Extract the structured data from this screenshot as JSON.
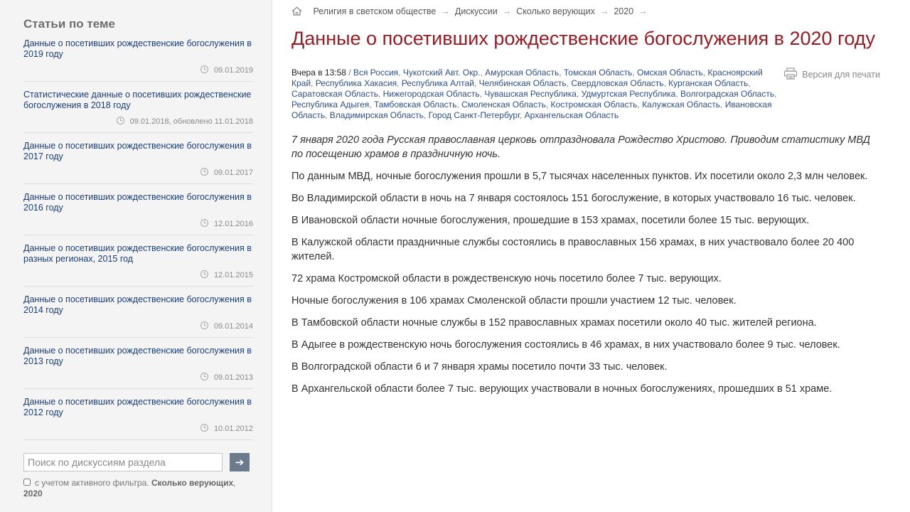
{
  "sidebar": {
    "title": "Статьи по теме",
    "articles": [
      {
        "title": "Данные о посетивших рождественские богослужения в 2019 году",
        "date": "09.01.2019"
      },
      {
        "title": "Статистические данные о посетивших рождественские богослужения в 2018 году",
        "date": "09.01.2018, обновлено 11.01.2018"
      },
      {
        "title": "Данные о посетивших рождественские богослужения в 2017 году",
        "date": "09.01.2017"
      },
      {
        "title": "Данные о посетивших рождественские богослужения в 2016 году",
        "date": "12.01.2016"
      },
      {
        "title": "Данные о посетивших рождественские богослужения в разных регионах, 2015 год",
        "date": "12.01.2015"
      },
      {
        "title": "Данные о посетивших рождественские богослужения в 2014 году",
        "date": "09.01.2014"
      },
      {
        "title": "Данные о посетивших рождественские богослужения в 2013 году",
        "date": "09.01.2013"
      },
      {
        "title": "Данные о посетивших рождественские богослужения в 2012 году",
        "date": "10.01.2012"
      }
    ],
    "search": {
      "placeholder": "Поиск по дискуссиям раздела",
      "button": "➔"
    },
    "filter": {
      "label": "с учетом активного фильтра.",
      "active": "Сколько верующих",
      "sep": ",",
      "year": "2020"
    }
  },
  "breadcrumb": {
    "items": [
      "Религия в светском обществе",
      "Дискуссии",
      "Сколько верующих",
      "2020"
    ],
    "arrow": "→"
  },
  "article": {
    "title": "Данные о посетивших рождественские богослужения в 2020 году",
    "time": "Вчера в 13:58",
    "slash": " / ",
    "regions": [
      "Вся Россия",
      "Чукотский Авт. Окр.",
      "Амурская Область",
      "Томская Область",
      "Омская Область",
      "Красноярский Край",
      "Республика Хакасия",
      "Республика Алтай",
      "Челябинская Область",
      "Свердловская Область",
      "Курганская Область",
      "Саратовская Область",
      "Нижегородская Область",
      "Чувашская Республика",
      "Удмуртская Республика",
      "Волгоградская Область",
      "Республика Адыгея",
      "Тамбовская Область",
      "Смоленская Область",
      "Костромская Область",
      "Калужская Область",
      "Ивановская Область",
      "Владимирская Область",
      "Город Санкт-Петербург",
      "Архангельская Область"
    ],
    "print_label": "Версия для печати",
    "lead": "7 января 2020 года Русская православная церковь отпраздновала Рождество Христово. Приводим статистику МВД по посещению храмов в праздничную ночь.",
    "paragraphs": [
      "По данным МВД, ночные богослужения прошли в 5,7 тысячах населенных пунктов. Их посетили около 2,3 млн человек.",
      "Во Владимирской области в ночь на 7 января состоялось 151 богослужение, в которых участвовало 16 тыс. человек.",
      "В Ивановской области ночные богослужения, прошедшие в 153 храмах, посетили более 15 тыс. верующих.",
      "В Калужской области праздничные службы состоялись в православных 156 храмах, в них участвовало более 20 400 жителей.",
      "72 храма Костромской области в рождественскую ночь посетило более 7 тыс. верующих.",
      "Ночные богослужения в 106 храмах Смоленской области прошли участием 12 тыс. человек.",
      "В Тамбовской области ночные службы в 152 православных храмах посетили около 40 тыс. жителей региона.",
      "В Адыгее в рождественскую ночь богослужения состоялись в 46 храмах, в них участвовало более 9 тыс. человек.",
      "В Волгоградской области 6 и 7 января храмы посетило почти 33 тыс. человек.",
      "В Архангельской области более 7 тыс. верующих участвовали в ночных богослужениях, прошедших в 51 храме."
    ]
  },
  "colors": {
    "title": "#9b1a24",
    "link": "#1a3e7a",
    "region": "#2f4f8a",
    "sidebar_bg": "#f4f4f4",
    "button": "#6b7a8c"
  }
}
